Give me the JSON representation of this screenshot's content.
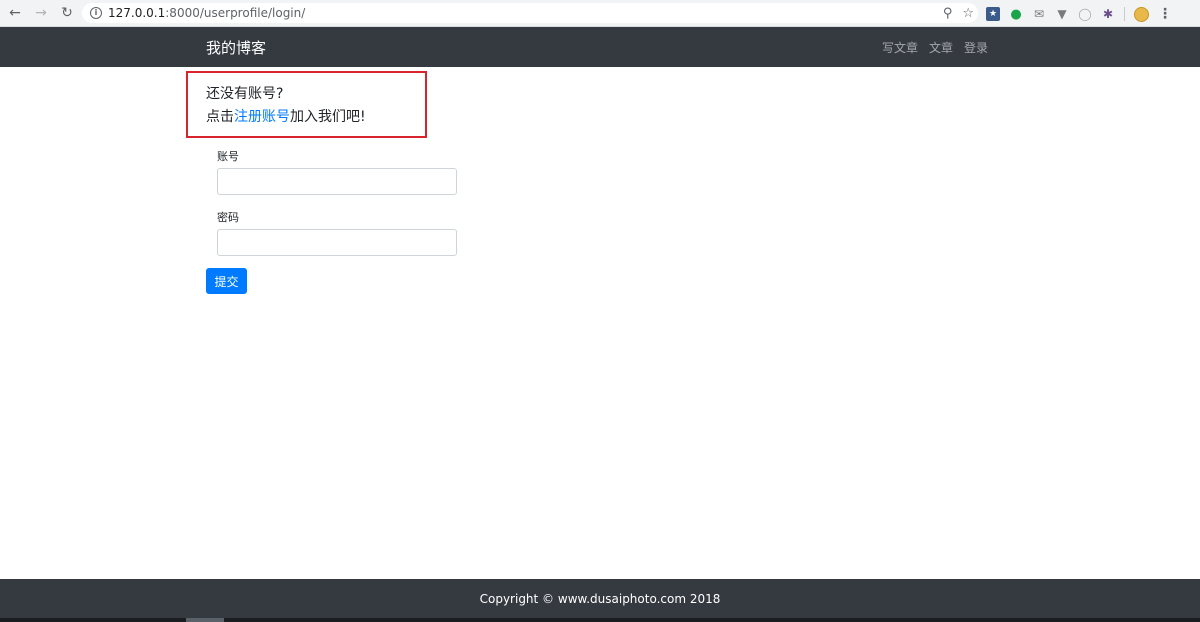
{
  "browser": {
    "url_host": "127.0.0.1",
    "url_path": ":8000/userprofile/login/",
    "icons": [
      "back-icon",
      "forward-icon",
      "reload-icon",
      "info-icon",
      "zoom-icon",
      "bookmark-star-icon",
      "menu-icon"
    ]
  },
  "navbar": {
    "brand": "我的博客",
    "links": [
      "写文章",
      "文章",
      "登录"
    ]
  },
  "notice": {
    "line1": "还没有账号?",
    "prefix": "点击",
    "link_text": "注册账号",
    "suffix": "加入我们吧!"
  },
  "form": {
    "username_label": "账号",
    "username_value": "",
    "password_label": "密码",
    "password_value": "",
    "submit_label": "提交"
  },
  "footer": {
    "text": "Copyright © www.dusaiphoto.com 2018"
  },
  "colors": {
    "navbar_bg": "#343a40",
    "accent": "#007bff",
    "notice_border": "#d9232d"
  }
}
